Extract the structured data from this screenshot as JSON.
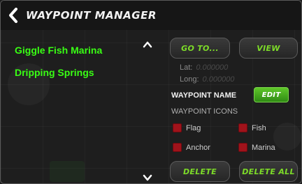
{
  "header": {
    "title": "WAYPOINT MANAGER"
  },
  "waypoints": [
    {
      "label": "Giggle Fish Marina"
    },
    {
      "label": "Dripping Springs"
    }
  ],
  "buttons": {
    "goto": "GO TO...",
    "view": "VIEW",
    "edit": "EDIT",
    "delete": "DELETE",
    "delete_all": "DELETE ALL"
  },
  "coords": {
    "lat_label": "Lat:",
    "lat_value": "0.000000",
    "long_label": "Long:",
    "long_value": "0.000000"
  },
  "labels": {
    "waypoint_name": "WAYPOINT NAME",
    "waypoint_icons": "WAYPOINT ICONS"
  },
  "icons": [
    {
      "label": "Flag"
    },
    {
      "label": "Fish"
    },
    {
      "label": "Anchor"
    },
    {
      "label": "Marina"
    }
  ],
  "colors": {
    "accent_green": "#39ff14",
    "button_text": "#7ddc28",
    "edit_button": "#4caf1e",
    "checkbox": "#a0131b"
  }
}
